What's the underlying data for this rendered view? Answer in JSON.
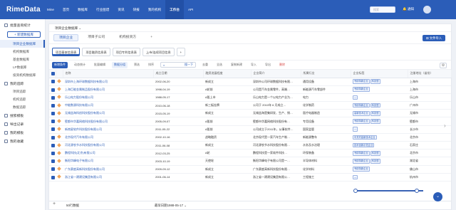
{
  "topbar": {
    "logo": "RimeData",
    "nav": [
      "Mine",
      "首页",
      "数据库",
      "行业图谱",
      "资讯",
      "研报",
      "我的机构",
      "工作台",
      "API"
    ],
    "active_index": 7,
    "search_placeholder": "搜索",
    "notice": "通知"
  },
  "sidebar": {
    "group1": "批量查询统计",
    "new_btn": "+ 新建数据库",
    "items1": [
      "项目企业数据库",
      "机构数据库",
      "基金数据库",
      "LP数据库",
      "投资机构数据库"
    ],
    "active_item": 0,
    "group2": "我的追踪",
    "items2": [
      "项目追踪",
      "机构追踪",
      "数据追踪"
    ],
    "group3": "搜索模板",
    "group4": "导出记录",
    "group5": "我的模板",
    "group6": "我的收藏"
  },
  "page": {
    "title": "项目企业数据库 ⌄"
  },
  "tabs1": {
    "items": [
      "项目企业",
      "项目子公司",
      "机构投资方"
    ],
    "active": 0,
    "plus": "+",
    "export": "⊞ 文件导入"
  },
  "tabs2": {
    "items": [
      "项目基本信息表",
      "项目融资信息表",
      "项目专利信息表",
      "上市/连续项目信息"
    ],
    "active": 0,
    "plus": "+"
  },
  "toolbar": {
    "new_data": "新增条件",
    "auto_update": "动态统计",
    "batch_update": "批量编辑",
    "group": "数据分组",
    "filter": "筛选",
    "sort": "排序",
    "search_value": "搜一下",
    "dedupe": "去重",
    "fill": "全选",
    "copy_new": "复制新建",
    "import": "导入",
    "export": "导出",
    "delete": "删除"
  },
  "table": {
    "headers": [
      "名称",
      "成立日期",
      "融资进展程度",
      "企业简介",
      "所属行业",
      "企业标签",
      "注册地址（省份）"
    ],
    "rows": [
      {
        "name": "深圳市上海环球数据科技有限公司",
        "date": "2002-06-20",
        "stage": "新成立",
        "desc": "深圳市公司环球数据科技有限…",
        "industry": "通用设备",
        "tags": [
          "专精特新企业",
          "科技型"
        ],
        "addr": "上海市"
      },
      {
        "name": "上海巨能金属制品股份有限公司",
        "date": "1998-04-19",
        "stage": "A轮前",
        "desc": "公司是汽车金属零件，高端…",
        "industry": "新能源汽车零部件",
        "tags": [
          "专精特新企业"
        ],
        "addr": "上海市"
      },
      {
        "name": "乐山电力股份有限公司",
        "date": "1988-05-17",
        "stage": "A股上市",
        "desc": "乐山电力是一个以电力产业为…",
        "industry": "电力",
        "tags": [
          "—"
        ],
        "addr": "乐山市"
      },
      {
        "name": "中能数源科技有限公司",
        "date": "2010-06-18",
        "stage": "新三板挂牌",
        "desc": "公司于 2010年 6 月成立…",
        "industry": "化学制药",
        "tags": [
          "专精特新企业",
          "科技型"
        ],
        "addr": "广州市"
      },
      {
        "name": "无锡益海科创科技股份有限公司",
        "date": "2015-05-19",
        "stage": "新成立",
        "desc": "无锡益海是集研发、生产、销…",
        "industry": "医疗电器制造",
        "tags": [
          "高新技术企业",
          "科技型"
        ],
        "addr": "无锡市"
      },
      {
        "name": "壁都市华嘉网络科技股份有限公司",
        "date": "2005-09-07",
        "stage": "A股前",
        "desc": "壁都市华嘉网络科技股份有…",
        "industry": "专用设备",
        "tags": [
          "专精特新企业",
          "科技型"
        ],
        "addr": "壁都市"
      },
      {
        "name": "新南星软件科技股份有限公司",
        "date": "2011-05-22",
        "stage": "A股前",
        "desc": "公司成立于2011年，从事软件…",
        "industry": "国家监管",
        "tags": [
          "—"
        ],
        "addr": "长沙市"
      },
      {
        "name": "北京现代汽车有限公司",
        "date": "2002-10-16",
        "stage": "战略融资",
        "desc": "北京现代是一家汽车生产制…",
        "industry": "新能源整车",
        "tags": [
          "中关村高新技术企业"
        ],
        "addr": "北京市"
      },
      {
        "name": "河北源农节水科技股份有限公司",
        "date": "2011-06-08",
        "stage": "新成立",
        "desc": "河北源农节水科技股份有限…",
        "industry": "水务及水治理",
        "tags": [
          "技术创新示范企业"
        ],
        "addr": "石家庄"
      },
      {
        "name": "鹏程科技(北京)有限公司",
        "date": "2012-03-25",
        "stage": "A轮",
        "desc": "鹏程科技是一家软件科技…",
        "industry": "环保装备",
        "tags": [
          "专精特新企业",
          "科技型"
        ],
        "addr": "北京市"
      },
      {
        "name": "衡阳华峰电子有限公司",
        "date": "2003-10-19",
        "stage": "天使轮",
        "desc": "衡阳华峰电子有限公司是一…",
        "industry": "半导体材料",
        "tags": [
          "专精特新企业",
          "科技型"
        ],
        "addr": "湖北省"
      },
      {
        "name": "广东赛度高新科技股份有限公司",
        "date": "2009-09-12",
        "stage": "新成立",
        "desc": "广东赛度高新科技股份有限…",
        "industry": "化学材料",
        "tags": [
          "专精特新企业"
        ],
        "addr": "佛山市"
      },
      {
        "name": "浙江省一建建设集团有限公司",
        "date": "2001-06-14",
        "stage": "新成立",
        "desc": "浙江省一建建设集团有限公…",
        "industry": "工程施工",
        "tags": [
          "—"
        ],
        "addr": "杭州市"
      }
    ]
  },
  "footer": {
    "plus": "+",
    "count": "50行数据",
    "summary": "最早日期1988-05-17 ⌄"
  }
}
